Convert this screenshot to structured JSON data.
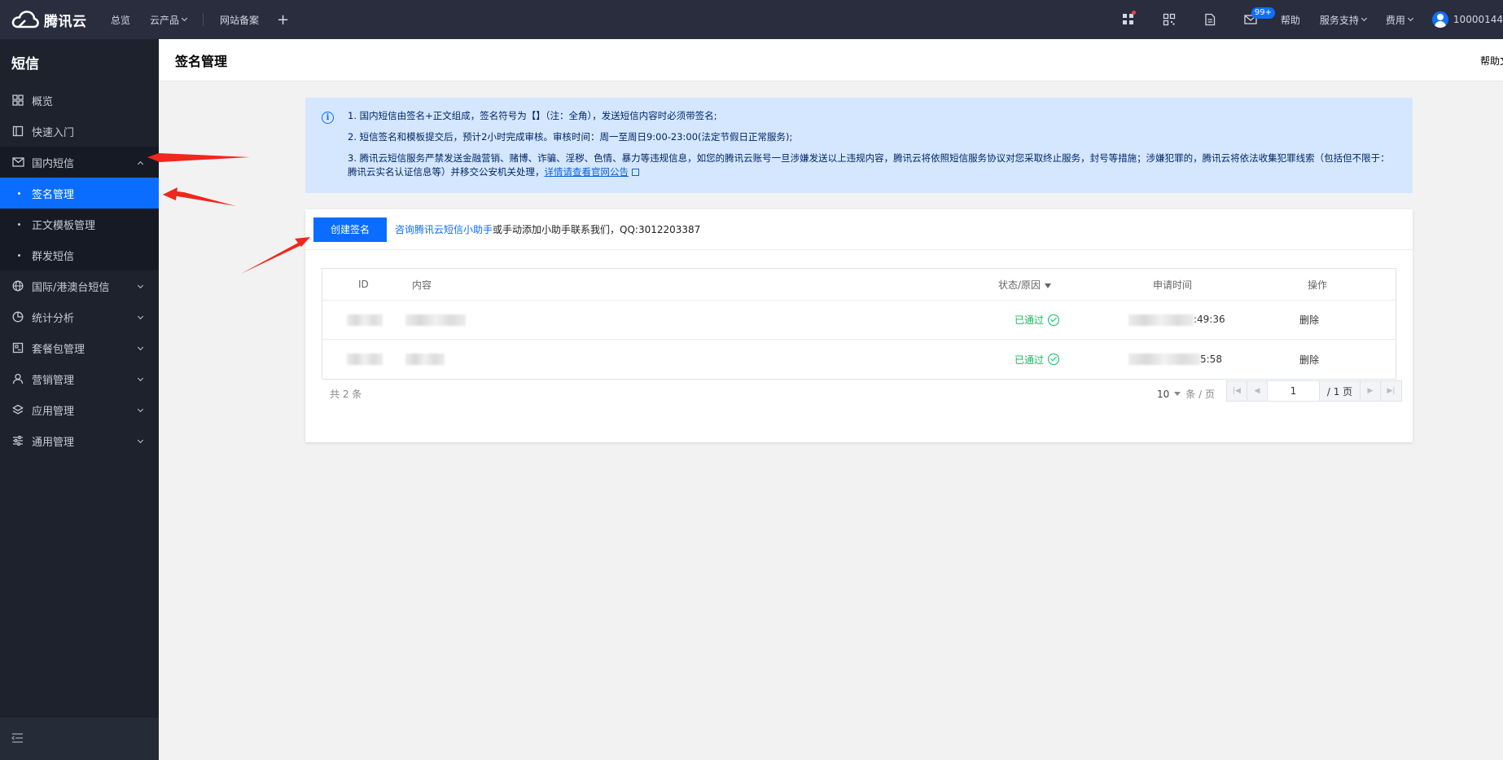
{
  "topbar": {
    "brand": "腾讯云",
    "nav": [
      {
        "label": "总览"
      },
      {
        "label": "云产品"
      },
      {
        "label": "网站备案"
      }
    ],
    "notification_count": "99+",
    "help_label": "帮助",
    "support_label": "服务支持",
    "billing_label": "费用",
    "account_id": "10000144"
  },
  "sidebar": {
    "title": "短信",
    "items": [
      {
        "label": "概览",
        "icon": "grid-icon"
      },
      {
        "label": "快速入门",
        "icon": "book-icon"
      },
      {
        "label": "国内短信",
        "icon": "mail-icon"
      },
      {
        "label": "国际/港澳台短信",
        "icon": "globe-icon"
      },
      {
        "label": "统计分析",
        "icon": "pie-chart-icon"
      },
      {
        "label": "套餐包管理",
        "icon": "package-icon"
      },
      {
        "label": "营销管理",
        "icon": "user-group-icon"
      },
      {
        "label": "应用管理",
        "icon": "layers-icon"
      },
      {
        "label": "通用管理",
        "icon": "sliders-icon"
      }
    ],
    "subitems": [
      {
        "label": "签名管理"
      },
      {
        "label": "正文模板管理"
      },
      {
        "label": "群发短信"
      }
    ]
  },
  "page": {
    "title": "签名管理",
    "help_link": "帮助文"
  },
  "notice": {
    "line1": "1. 国内短信由签名+正文组成，签名符号为【】（注：全角），发送短信内容时必须带签名;",
    "line2": "2. 短信签名和模板提交后，预计2小时完成审核。审核时间：周一至周日9:00-23:00(法定节假日正常服务);",
    "line3": "3. 腾讯云短信服务严禁发送金融营销、赌博、诈骗、淫秽、色情、暴力等违规信息，如您的腾讯云账号一旦涉嫌发送以上违规内容，腾讯云将依照短信服务协议对您采取终止服务，封号等措施；涉嫌犯罪的，腾讯云将依法收集犯罪线索（包括但不限于：腾讯云实名认证信息等）并移交公安机关处理，",
    "line3_link": "详情请查看官网公告"
  },
  "toolbar": {
    "create_label": "创建签名",
    "consult_link": "咨询腾讯云短信小助手",
    "consult_text": "或手动添加小助手联系我们，QQ:3012203387"
  },
  "table": {
    "columns": {
      "id": "ID",
      "content": "内容",
      "status": "状态/原因",
      "time": "申请时间",
      "op": "操作"
    },
    "rows": [
      {
        "status": "已通过",
        "time_tail": ":49:36",
        "op": "删除"
      },
      {
        "status": "已通过",
        "time_tail": "5:58",
        "op": "删除"
      }
    ]
  },
  "pager": {
    "total_text": "共 2 条",
    "page_size": "10",
    "page_size_unit": "条 / 页",
    "current_page": "1",
    "total_pages": "/ 1 页"
  },
  "colors": {
    "topbar_bg": "#292d3e",
    "sidebar_bg": "#1e222d",
    "primary": "#0a6dff",
    "success": "#0abf5b",
    "notice_bg": "#d5e7ff",
    "annotation": "#f0271c"
  }
}
